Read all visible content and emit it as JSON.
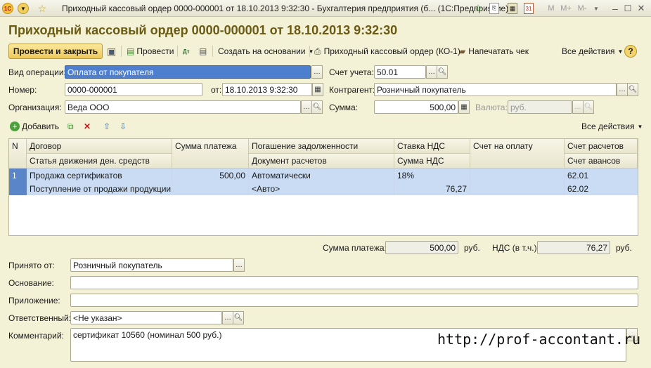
{
  "window": {
    "title": "Приходный кассовый ордер 0000-000001 от 18.10.2013 9:32:30 - Бухгалтерия предприятия (б... (1С:Предприятие)",
    "right_buttons": [
      "M",
      "M+",
      "M-"
    ]
  },
  "form": {
    "title": "Приходный кассовый ордер 0000-000001 от 18.10.2013 9:32:30"
  },
  "toolbar": {
    "post_close": "Провести и закрыть",
    "post": "Провести",
    "create_based": "Создать на основании",
    "print_ko1": "Приходный кассовый ордер (КО-1)",
    "print_check": "Напечатать чек",
    "all_actions": "Все действия",
    "help": "?"
  },
  "fields": {
    "op_type_label": "Вид операции:",
    "op_type_value": "Оплата от покупателя",
    "number_label": "Номер:",
    "number_value": "0000-000001",
    "date_label": "от:",
    "date_value": "18.10.2013  9:32:30",
    "org_label": "Организация:",
    "org_value": "Веда ООО",
    "account_label": "Счет учета:",
    "account_value": "50.01",
    "counterparty_label": "Контрагент:",
    "counterparty_value": "Розничный покупатель",
    "sum_label": "Сумма:",
    "sum_value": "500,00",
    "currency_label": "Валюта:",
    "currency_value": "руб."
  },
  "table_toolbar": {
    "add": "Добавить",
    "all_actions": "Все действия"
  },
  "table": {
    "headers_top": [
      "N",
      "Договор",
      "Сумма платежа",
      "Погашение задолженности",
      "Ставка НДС",
      "Счет на оплату",
      "Счет расчетов"
    ],
    "headers_bottom": [
      "Статья движения ден. средств",
      "Документ расчетов",
      "Сумма НДС",
      "Счет авансов"
    ],
    "rows": [
      {
        "n": "1",
        "contract": "Продажа сертификатов",
        "cash_flow_item": "Поступление от продажи продукции ...",
        "amount": "500,00",
        "repayment": "Автоматически",
        "settlement_doc": "<Авто>",
        "vat_rate": "18%",
        "vat_amount": "76,27",
        "invoice": "",
        "settlement_account": "62.01",
        "advance_account": "62.02"
      }
    ]
  },
  "totals": {
    "payment_label": "Сумма платежа:",
    "payment_value": "500,00",
    "payment_currency": "руб.",
    "vat_label": "НДС (в т.ч.):",
    "vat_value": "76,27",
    "vat_currency": "руб."
  },
  "bottom": {
    "received_from_label": "Принято от:",
    "received_from_value": "Розничный покупатель",
    "basis_label": "Основание:",
    "basis_value": "",
    "attachment_label": "Приложение:",
    "attachment_value": "",
    "responsible_label": "Ответственный:",
    "responsible_value": "<Не указан>",
    "comment_label": "Комментарий:",
    "comment_value": "сертификат  10560 (номинал 500 руб.)"
  },
  "watermark": "http://prof-accontant.ru",
  "colors": {
    "background": "#f3f1d6",
    "title_text": "#6b5a12",
    "selection": "#4e7fce",
    "row_highlight": "#c9dcf3"
  }
}
